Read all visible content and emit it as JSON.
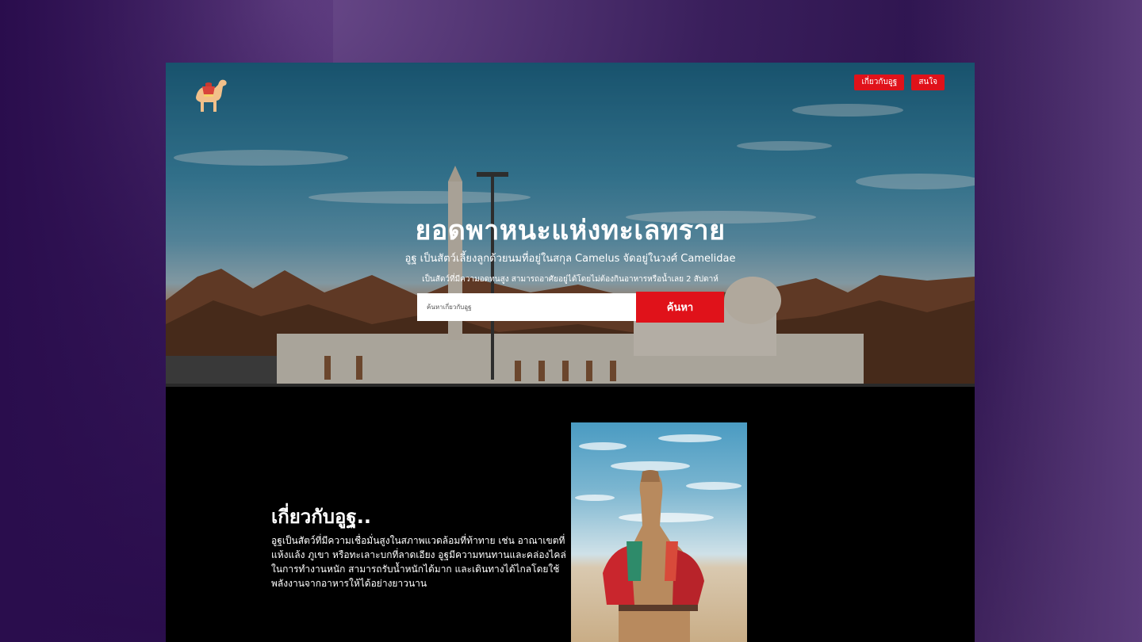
{
  "nav": {
    "items": [
      {
        "label": "เกี่ยวกับอูฐ"
      },
      {
        "label": "สนใจ"
      }
    ]
  },
  "hero": {
    "title": "ยอดพาหนะแห่งทะเลทราย",
    "subtitle": "อูฐ เป็นสัตว์เลี้ยงลูกด้วยนมที่อยู่ในสกุล Camelus จัดอยู่ในวงศ์ Camelidae",
    "subtitle2": "เป็นสัตว์ที่มีความอดทนสูง สามารถอาศัยอยู่ได้โดยไม่ต้องกินอาหารหรือน้ำเลย 2 สัปดาห์"
  },
  "search": {
    "placeholder": "ค้นหาเกี่ยวกับอูฐ",
    "button_label": "ค้นหา"
  },
  "about": {
    "title": "เกี่ยวกับอูฐ..",
    "text": "อูฐเป็นสัตว์ที่มีความเชื่อมั่นสูงในสภาพแวดล้อมที่ท้าทาย เช่น อาณาเขตที่แห้งแล้ง ภูเขา หรือทะเลาะบกที่ลาดเอียง อูฐมีความทนทานและคล่องไคล่ในการทำงานหนัก สามารถรับน้ำหนักได้มาก และเดินทางได้ไกลโดยใช้พลังงานจากอาหารให้ได้อย่างยาวนาน"
  },
  "colors": {
    "accent": "#e0121a",
    "section_bg": "#000000",
    "text": "#ffffff"
  }
}
